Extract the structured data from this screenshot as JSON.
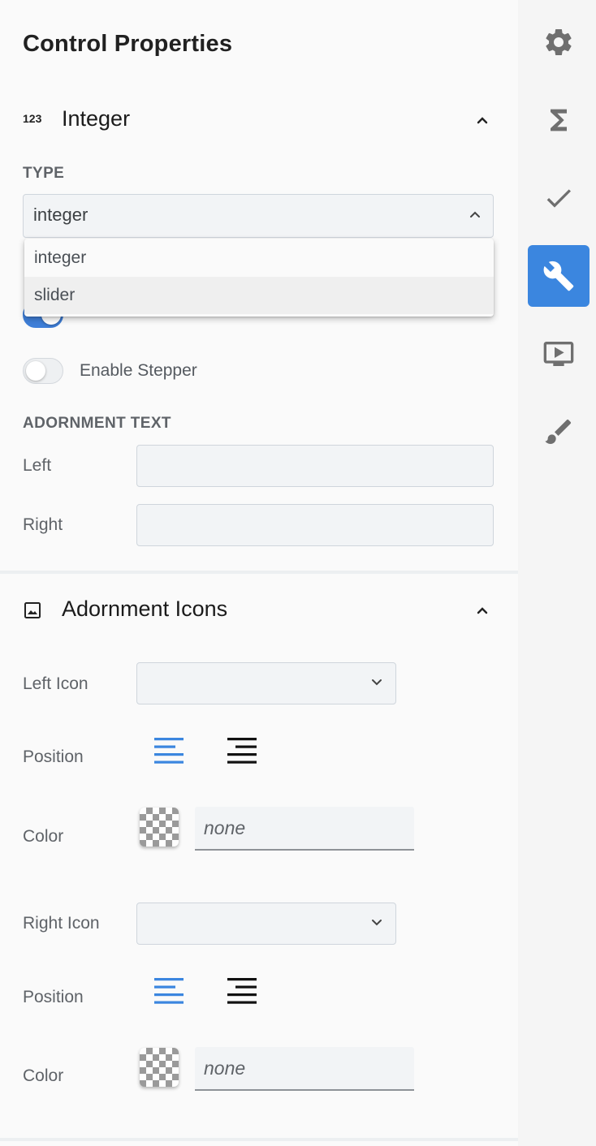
{
  "panel": {
    "title": "Control Properties",
    "integer_section": {
      "title": "Integer",
      "type_label": "TYPE",
      "type_value": "integer",
      "type_options": [
        "integer",
        "slider"
      ],
      "stepper_label": "Enable Stepper",
      "adornment_text_label": "ADORNMENT TEXT",
      "left_label": "Left",
      "right_label": "Right",
      "left_value": "",
      "right_value": ""
    },
    "icons_section": {
      "title": "Adornment Icons",
      "left_icon_label": "Left Icon",
      "right_icon_label": "Right Icon",
      "position_label": "Position",
      "color_label": "Color",
      "left_color_value": "none",
      "right_color_value": "none",
      "color_placeholder": "none"
    }
  },
  "rail": {
    "items": [
      "settings",
      "formula",
      "validation",
      "tools",
      "preview",
      "style"
    ],
    "active": "tools"
  },
  "colors": {
    "accent": "#3b86df",
    "toggle_on": "#3f7fd8",
    "icon_gray": "#707070"
  }
}
